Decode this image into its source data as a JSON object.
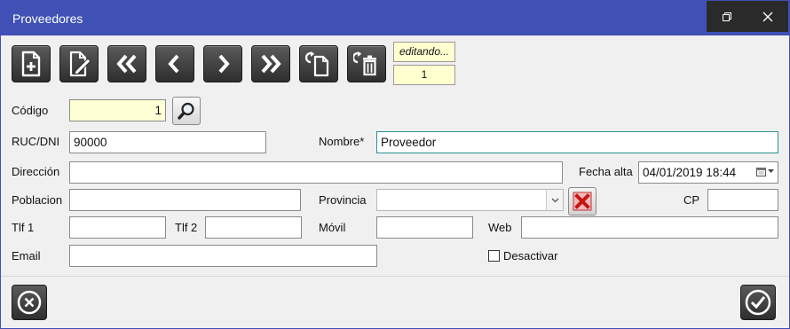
{
  "window": {
    "title": "Proveedores",
    "controls": [
      "restore-icon",
      "close-icon"
    ]
  },
  "toolbar": {
    "buttons": [
      {
        "name": "new-record-button",
        "icon": "new-document-icon"
      },
      {
        "name": "edit-record-button",
        "icon": "edit-document-icon"
      },
      {
        "name": "first-record-button",
        "icon": "double-chevron-left-icon"
      },
      {
        "name": "previous-record-button",
        "icon": "chevron-left-icon"
      },
      {
        "name": "next-record-button",
        "icon": "chevron-right-icon"
      },
      {
        "name": "last-record-button",
        "icon": "double-chevron-right-icon"
      },
      {
        "name": "duplicate-record-button",
        "icon": "copy-icon"
      },
      {
        "name": "delete-record-button",
        "icon": "trash-icon"
      }
    ],
    "status": "editando...",
    "record_number": "1"
  },
  "form": {
    "codigo": {
      "label": "Código",
      "value": "1"
    },
    "ruc": {
      "label": "RUC/DNI",
      "value": "90000"
    },
    "nombre": {
      "label": "Nombre*",
      "value": "Proveedor"
    },
    "direccion": {
      "label": "Dirección",
      "value": ""
    },
    "fecha_alta": {
      "label": "Fecha alta",
      "value": "04/01/2019 18:44"
    },
    "poblacion": {
      "label": "Poblacion",
      "value": ""
    },
    "provincia": {
      "label": "Provincia",
      "value": ""
    },
    "cp": {
      "label": "CP",
      "value": ""
    },
    "tlf1": {
      "label": "Tlf 1",
      "value": ""
    },
    "tlf2": {
      "label": "Tlf 2",
      "value": ""
    },
    "movil": {
      "label": "Móvil",
      "value": ""
    },
    "web": {
      "label": "Web",
      "value": ""
    },
    "email": {
      "label": "Email",
      "value": ""
    },
    "desactivar": {
      "label": "Desactivar",
      "checked": false
    }
  },
  "footer": {
    "cancel_icon": "cancel-circle-icon",
    "accept_icon": "check-circle-icon"
  },
  "colors": {
    "titlebar": "#3f51b5",
    "highlight_field": "#ffffd6",
    "dark_button": "#3a3a3a"
  }
}
